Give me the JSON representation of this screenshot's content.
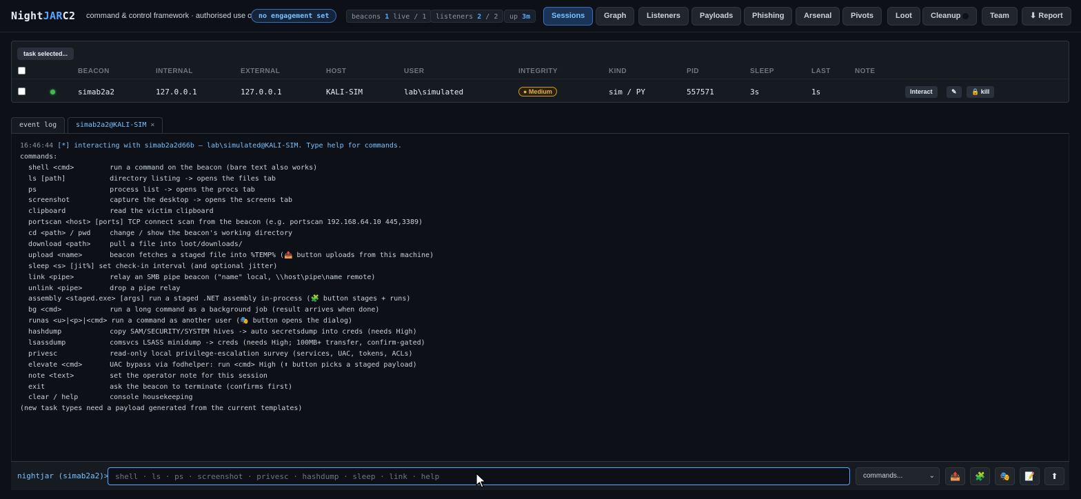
{
  "app": {
    "brand_prefix": "Night",
    "brand_accent": "JAR",
    "brand_suffix": "C2",
    "tagline": "command & control framework · authorised use only",
    "engagement": "no engagement set"
  },
  "stats": {
    "beacons_label": "beacons",
    "beacons_live": "1",
    "beacons_rest": "live / 1",
    "listeners_label": "listeners",
    "listeners_value": "2",
    "listeners_rest": "/ 2",
    "up_label": "up",
    "up_value": "3m"
  },
  "nav": [
    "Sessions",
    "Graph",
    "Listeners",
    "Payloads",
    "Phishing",
    "Arsenal",
    "Pivots",
    "Loot",
    "Cleanup",
    "Team",
    "⬇ Report"
  ],
  "sessions": {
    "task_badge": "task selected...",
    "headers": [
      "BEACON",
      "INTERNAL",
      "EXTERNAL",
      "HOST",
      "USER",
      "INTEGRITY",
      "KIND",
      "PID",
      "SLEEP",
      "LAST",
      "NOTE"
    ],
    "row": {
      "beacon": "simab2a2",
      "internal": "127.0.0.1",
      "external": "127.0.0.1",
      "host": "KALI-SIM",
      "user": "lab\\simulated",
      "integrity": "● Medium",
      "kind": "sim / PY",
      "pid": "557571",
      "sleep": "3s",
      "last": "1s",
      "note": ""
    },
    "actions": {
      "interact": "Interact",
      "edit": "✎",
      "kill": "🔒 kill"
    }
  },
  "tabs": {
    "event_log": "event log",
    "session": "simab2a2@KALI-SIM",
    "close": "×"
  },
  "console": {
    "timestamp": "16:46:44",
    "intro": "[*] interacting with simab2a2d66b — lab\\simulated@KALI-SIM. Type help for commands.",
    "commands_header": "commands:",
    "commands": [
      [
        "shell <cmd>",
        "run a command on the beacon (bare text also works)"
      ],
      [
        "ls [path]",
        "directory listing -> opens the files tab"
      ],
      [
        "ps",
        "process list -> opens the procs tab"
      ],
      [
        "screenshot",
        "capture the desktop -> opens the screens tab"
      ],
      [
        "clipboard",
        "read the victim clipboard"
      ],
      [
        "portscan <host> [ports]",
        "TCP connect scan from the beacon (e.g. portscan 192.168.64.10 445,3389)"
      ],
      [
        "cd <path> / pwd",
        "change / show the beacon's working directory"
      ],
      [
        "download <path>",
        "pull a file into loot/downloads/"
      ],
      [
        "upload <name>",
        "beacon fetches a staged file into %TEMP% (📤 button uploads from this machine)"
      ],
      [
        "sleep <s> [jit%]",
        "set check-in interval (and optional jitter)"
      ],
      [
        "link <pipe>",
        "relay an SMB pipe beacon (\"name\" local, \\\\host\\pipe\\name remote)"
      ],
      [
        "unlink <pipe>",
        "drop a pipe relay"
      ],
      [
        "assembly <staged.exe> [args]",
        "run a staged .NET assembly in-process (🧩 button stages + runs)"
      ],
      [
        "bg <cmd>",
        "run a long command as a background job (result arrives when done)"
      ],
      [
        "runas <u>|<p>|<cmd>",
        "run a command as another user (🎭 button opens the dialog)"
      ],
      [
        "hashdump",
        "copy SAM/SECURITY/SYSTEM hives -> auto secretsdump into creds (needs High)"
      ],
      [
        "lsassdump",
        "comsvcs LSASS minidump -> creds (needs High; 100MB+ transfer, confirm-gated)"
      ],
      [
        "privesc",
        "read-only local privilege-escalation survey (services, UAC, tokens, ACLs)"
      ],
      [
        "elevate <cmd>",
        "UAC bypass via fodhelper: run <cmd> High (⬆ button picks a staged payload)"
      ],
      [
        "note <text>",
        "set the operator note for this session"
      ],
      [
        "exit",
        "ask the beacon to terminate (confirms first)"
      ],
      [
        "clear / help",
        "console housekeeping"
      ]
    ],
    "footer": "(new task types need a payload generated from the current templates)"
  },
  "prompt": {
    "label": "nightjar (simab2a2)>",
    "placeholder": "shell · ls · ps · screenshot · privesc · hashdump · sleep · link · help",
    "value": "",
    "select": "commands...",
    "icons": [
      "📤",
      "🧩",
      "🎭",
      "📝",
      "⬆"
    ]
  },
  "colors": {
    "background": "#0d1117",
    "accent": "#58a6ff",
    "live": "#3fb950",
    "integrity_medium": "#e3b341"
  }
}
